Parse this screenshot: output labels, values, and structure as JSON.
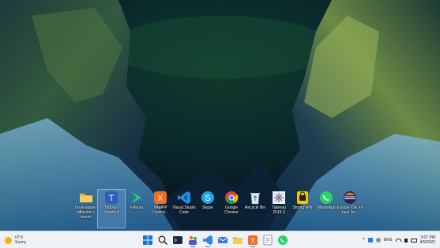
{
  "desktop": {
    "icons": [
      {
        "label": "hook-stable-diffusion-v-model",
        "icon": "folder-icon",
        "color": "#e8b33a"
      },
      {
        "label": "Typora - Shortcut",
        "icon": "typora-icon",
        "color": "#2d5fb8"
      },
      {
        "label": "Filmora",
        "icon": "filmora-icon",
        "color": "#3bbf9a"
      },
      {
        "label": "XAMPP Control...",
        "icon": "xampp-icon",
        "color": "#f26d21"
      },
      {
        "label": "Visual Studio Code",
        "icon": "vscode-icon",
        "color": "#2a8be0"
      },
      {
        "label": "Skype",
        "icon": "skype-icon",
        "color": "#1fa3e8"
      },
      {
        "label": "Google Chrome",
        "icon": "chrome-icon",
        "color": "#db4437"
      },
      {
        "label": "Recycle Bin",
        "icon": "recycle-bin-icon",
        "color": "#d8e6f5"
      },
      {
        "label": "Tableau 2019.3",
        "icon": "tableau-icon",
        "color": "#e8edf4"
      },
      {
        "label": "StrongVPN",
        "icon": "strongvpn-icon",
        "color": "#f0c400"
      },
      {
        "label": "WhatsApp",
        "icon": "whatsapp-icon",
        "color": "#25d366"
      },
      {
        "label": "Eclipse IDE for Java De...",
        "icon": "eclipse-icon",
        "color": "#2c2255"
      }
    ]
  },
  "taskbar": {
    "weather": {
      "temp": "67°F",
      "condition": "Sunny"
    },
    "pinned": [
      "start-icon",
      "search-icon",
      "terminal-icon",
      "teams-icon",
      "vscode-icon",
      "mail-icon",
      "explorer-icon",
      "xampp-icon",
      "notepad-icon",
      "whatsapp-icon"
    ],
    "tray": {
      "lang": "ENG",
      "time": "3:07 PM",
      "date": "4/5/2022"
    }
  }
}
